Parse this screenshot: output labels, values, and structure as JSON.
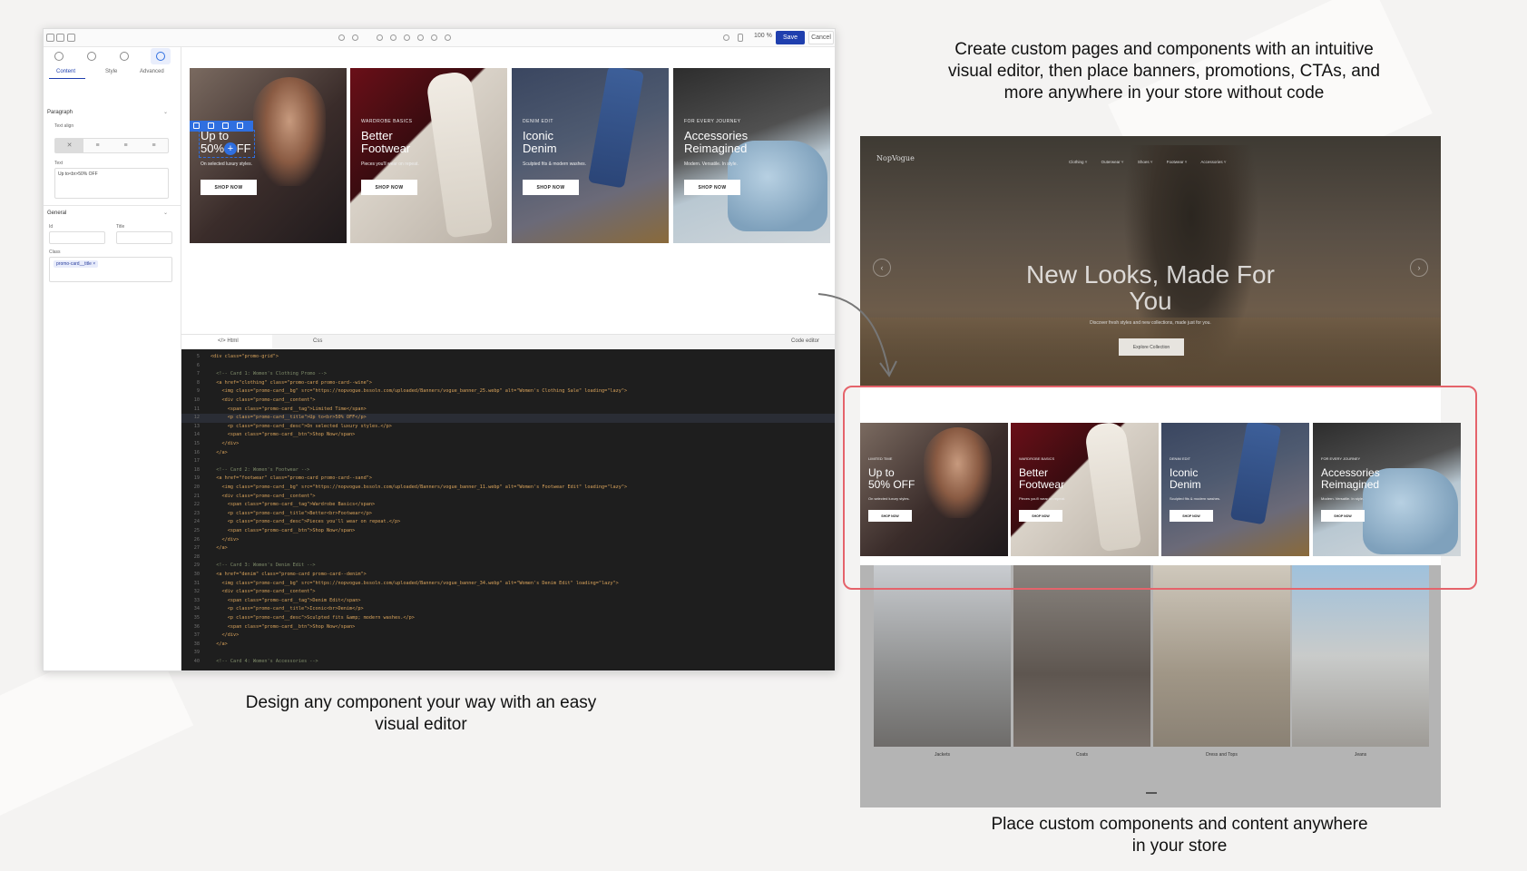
{
  "captions": {
    "top_right": "Create custom pages and components with an intuitive visual editor, then place banners, promotions, CTAs, and more anywhere in your store without code",
    "bottom_left": "Design any component your way with an easy visual editor",
    "bottom_right": "Place custom components and content anywhere in your store"
  },
  "editor": {
    "toolbar": {
      "zoom": "100 %",
      "save_label": "Save",
      "cancel_label": "Cancel"
    },
    "sidebar": {
      "tabs": [
        "Content",
        "Style",
        "Advanced"
      ],
      "paragraph_section": "Paragraph",
      "text_align_label": "Text align",
      "align_options": [
        "✕",
        "≡",
        "≡",
        "≡"
      ],
      "text_label": "Text",
      "text_value": "Up to<br>50% OFF",
      "general_section": "General",
      "id_label": "Id",
      "title_label": "Title",
      "class_label": "Class",
      "class_chip": "promo-card__title ×"
    },
    "canvas_cards": [
      {
        "tag": "",
        "title_line1": "Up to",
        "title_line2": "50% OFF",
        "desc": "On selected luxury styles.",
        "button": "SHOP NOW"
      },
      {
        "tag": "WARDROBE BASICS",
        "title_line1": "Better",
        "title_line2": "Footwear",
        "desc": "Pieces you'll wear on repeat.",
        "button": "SHOP NOW"
      },
      {
        "tag": "DENIM EDIT",
        "title_line1": "Iconic",
        "title_line2": "Denim",
        "desc": "Sculpted fits & modern washes.",
        "button": "SHOP NOW"
      },
      {
        "tag": "FOR EVERY JOURNEY",
        "title_line1": "Accessories",
        "title_line2": "Reimagined",
        "desc": "Modern. Versatile. In style.",
        "button": "SHOP NOW"
      }
    ],
    "code_tabs": [
      "</> Html",
      "Css",
      "Code editor"
    ],
    "code_lines": [
      {
        "n": "5",
        "text": "<div class=\"promo-grid\">"
      },
      {
        "n": "6",
        "text": ""
      },
      {
        "n": "7",
        "text": "  <!-- Card 1: Women's Clothing Promo -->"
      },
      {
        "n": "8",
        "text": "  <a href=\"clothing\" class=\"promo-card promo-card--wine\">"
      },
      {
        "n": "9",
        "text": "    <img class=\"promo-card__bg\" src=\"https://nopvogue.bssoln.com/uploaded/Banners/vogue_banner_25.webp\" alt=\"Women's Clothing Sale\" loading=\"lazy\">"
      },
      {
        "n": "10",
        "text": "    <div class=\"promo-card__content\">"
      },
      {
        "n": "11",
        "text": "      <span class=\"promo-card__tag\">Limited Time</span>"
      },
      {
        "n": "12",
        "text": "      <p class=\"promo-card__title\">Up to<br>50% OFF</p>"
      },
      {
        "n": "13",
        "text": "      <p class=\"promo-card__desc\">On selected luxury styles.</p>"
      },
      {
        "n": "14",
        "text": "      <span class=\"promo-card__btn\">Shop Now</span>"
      },
      {
        "n": "15",
        "text": "    </div>"
      },
      {
        "n": "16",
        "text": "  </a>"
      },
      {
        "n": "17",
        "text": ""
      },
      {
        "n": "18",
        "text": "  <!-- Card 2: Women's Footwear -->"
      },
      {
        "n": "19",
        "text": "  <a href=\"footwear\" class=\"promo-card promo-card--sand\">"
      },
      {
        "n": "20",
        "text": "    <img class=\"promo-card__bg\" src=\"https://nopvogue.bssoln.com/uploaded/Banners/vogue_banner_11.webp\" alt=\"Women's Footwear Edit\" loading=\"lazy\">"
      },
      {
        "n": "21",
        "text": "    <div class=\"promo-card__content\">"
      },
      {
        "n": "22",
        "text": "      <span class=\"promo-card__tag\">Wardrobe Basics</span>"
      },
      {
        "n": "23",
        "text": "      <p class=\"promo-card__title\">Better<br>Footwear</p>"
      },
      {
        "n": "24",
        "text": "      <p class=\"promo-card__desc\">Pieces you'll wear on repeat.</p>"
      },
      {
        "n": "25",
        "text": "      <span class=\"promo-card__btn\">Shop Now</span>"
      },
      {
        "n": "26",
        "text": "    </div>"
      },
      {
        "n": "27",
        "text": "  </a>"
      },
      {
        "n": "28",
        "text": ""
      },
      {
        "n": "29",
        "text": "  <!-- Card 3: Women's Denim Edit -->"
      },
      {
        "n": "30",
        "text": "  <a href=\"denim\" class=\"promo-card promo-card--denim\">"
      },
      {
        "n": "31",
        "text": "    <img class=\"promo-card__bg\" src=\"https://nopvogue.bssoln.com/uploaded/Banners/vogue_banner_34.webp\" alt=\"Women's Denim Edit\" loading=\"lazy\">"
      },
      {
        "n": "32",
        "text": "    <div class=\"promo-card__content\">"
      },
      {
        "n": "33",
        "text": "      <span class=\"promo-card__tag\">Denim Edit</span>"
      },
      {
        "n": "34",
        "text": "      <p class=\"promo-card__title\">Iconic<br>Denim</p>"
      },
      {
        "n": "35",
        "text": "      <p class=\"promo-card__desc\">Sculpted fits &amp; modern washes.</p>"
      },
      {
        "n": "36",
        "text": "      <span class=\"promo-card__btn\">Shop Now</span>"
      },
      {
        "n": "37",
        "text": "    </div>"
      },
      {
        "n": "38",
        "text": "  </a>"
      },
      {
        "n": "39",
        "text": ""
      },
      {
        "n": "40",
        "text": "  <!-- Card 4: Women's Accessories -->"
      }
    ]
  },
  "store": {
    "logo": "NopVogue",
    "nav": [
      "Clothing ˅",
      "Outerwear ˅",
      "Shoes ˅",
      "Footwear ˅",
      "Accessories ˅"
    ],
    "hero_title": "New Looks, Made For You",
    "hero_subtitle": "Discover fresh styles and new collections, made just for you.",
    "hero_button": "Explore Collection",
    "promo_cards": [
      {
        "tag": "LIMITED TIME",
        "title_line1": "Up to",
        "title_line2": "50% OFF",
        "desc": "On selected luxury styles.",
        "button": "SHOP NOW"
      },
      {
        "tag": "WARDROBE BASICS",
        "title_line1": "Better",
        "title_line2": "Footwear",
        "desc": "Pieces you'll wear on repeat.",
        "button": "SHOP NOW"
      },
      {
        "tag": "DENIM EDIT",
        "title_line1": "Iconic",
        "title_line2": "Denim",
        "desc": "Sculpted fits & modern washes.",
        "button": "SHOP NOW"
      },
      {
        "tag": "FOR EVERY JOURNEY",
        "title_line1": "Accessories",
        "title_line2": "Reimagined",
        "desc": "Modern. Versatile. In style.",
        "button": "SHOP NOW"
      }
    ],
    "categories": [
      "Jackets",
      "Coats",
      "Dress and Tops",
      "Jeans"
    ]
  },
  "colors": {
    "accent": "#1f3fae",
    "highlight_border": "#e5636b",
    "selection": "#2f6fe0"
  }
}
